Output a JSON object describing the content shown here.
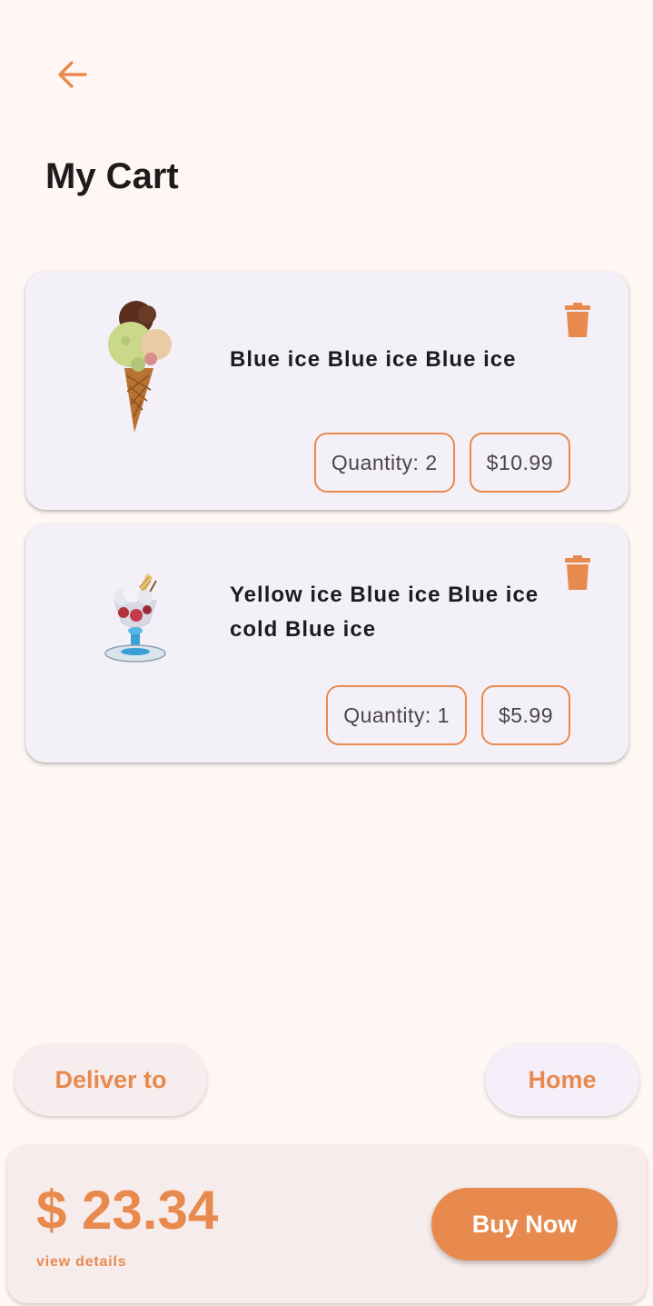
{
  "header": {
    "back_icon": "arrow-left-icon",
    "title": "My Cart"
  },
  "cart": {
    "items": [
      {
        "image": "ice-cream-cone-image",
        "name": "Blue ice Blue ice Blue ice",
        "quantity_label": "Quantity: 2",
        "price": "$10.99",
        "delete_icon": "trash-icon"
      },
      {
        "image": "sundae-glass-image",
        "name": "Yellow ice Blue ice Blue ice cold Blue ice",
        "quantity_label": "Quantity: 1",
        "price": "$5.99",
        "delete_icon": "trash-icon"
      }
    ]
  },
  "delivery": {
    "deliver_label": "Deliver to",
    "location": "Home"
  },
  "checkout": {
    "total": "$ 23.34",
    "details_link": "view details",
    "buy_label": "Buy Now"
  },
  "colors": {
    "accent": "#E88A4E",
    "background": "#FFF7F3",
    "card": "#F4F0F7",
    "text": "#1E1B1F"
  }
}
